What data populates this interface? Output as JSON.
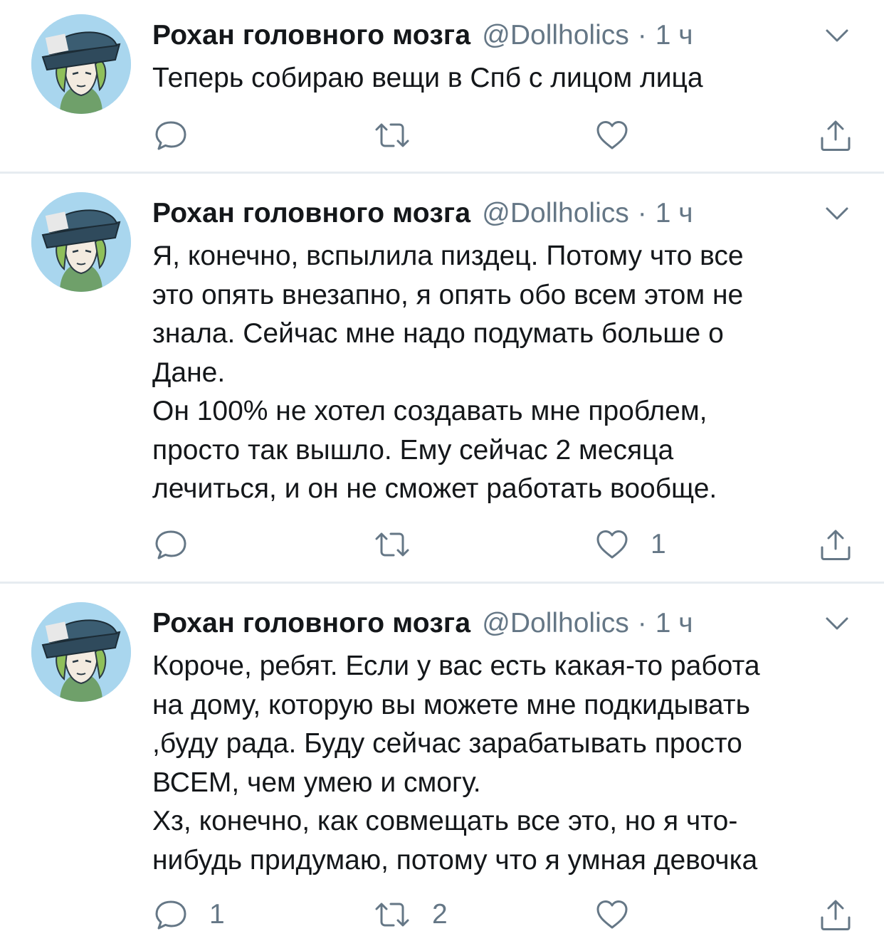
{
  "colors": {
    "text": "#14171a",
    "secondary": "#657786",
    "divider": "#e6ecf0",
    "avatar_bg": "#a9d6ee"
  },
  "icons": {
    "reply": "reply-icon",
    "retweet": "retweet-icon",
    "like": "heart-icon",
    "share": "share-icon",
    "menu": "chevron-down-icon"
  },
  "tweets": [
    {
      "name": "Рохан головного мозга",
      "handle": "@Dollholics",
      "separator": "·",
      "time": "1 ч",
      "lines": [
        "Теперь собираю вещи в Спб с лицом лица"
      ],
      "reply_count": "",
      "retweet_count": "",
      "like_count": ""
    },
    {
      "name": "Рохан головного мозга",
      "handle": "@Dollholics",
      "separator": "·",
      "time": "1 ч",
      "lines": [
        "Я, конечно, вспылила пиздец. Потому что все",
        "это опять внезапно, я опять обо всем этом не",
        "знала. Сейчас мне надо подумать больше о",
        "Дане.",
        "Он 100% не хотел создавать мне проблем,",
        "просто так вышло. Ему сейчас 2 месяца",
        "лечиться, и он не сможет работать вообще."
      ],
      "reply_count": "",
      "retweet_count": "",
      "like_count": "1"
    },
    {
      "name": "Рохан головного мозга",
      "handle": "@Dollholics",
      "separator": "·",
      "time": "1 ч",
      "lines": [
        "Короче,  ребят. Если у вас есть какая-то работа",
        "на дому, которую вы можете мне подкидывать",
        ",буду рада. Буду сейчас зарабатывать просто",
        "ВСЕМ, чем умею и смогу.",
        "Хз,  конечно, как совмещать все это,  но я что-",
        "нибудь придумаю, потому что я умная девочка"
      ],
      "reply_count": "1",
      "retweet_count": "2",
      "like_count": ""
    }
  ]
}
